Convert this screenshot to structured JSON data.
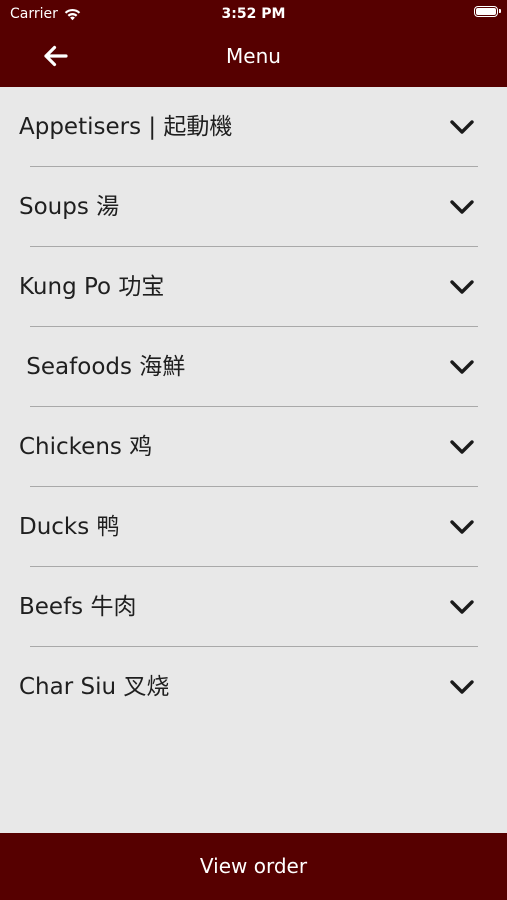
{
  "status_bar": {
    "carrier": "Carrier",
    "time": "3:52 PM",
    "icons": [
      "wifi-icon",
      "battery-icon"
    ]
  },
  "nav": {
    "title": "Menu",
    "back_icon": "arrow-left-icon"
  },
  "categories": [
    {
      "label": "Appetisers | 起動機",
      "icon": "chevron-down-icon"
    },
    {
      "label": "Soups 湯",
      "icon": "chevron-down-icon"
    },
    {
      "label": "Kung Po 功宝",
      "icon": "chevron-down-icon"
    },
    {
      "label": " Seafoods 海鮮",
      "icon": "chevron-down-icon"
    },
    {
      "label": "Chickens 鸡",
      "icon": "chevron-down-icon"
    },
    {
      "label": "Ducks 鸭",
      "icon": "chevron-down-icon"
    },
    {
      "label": "Beefs 牛肉",
      "icon": "chevron-down-icon"
    },
    {
      "label": "Char Siu 叉烧",
      "icon": "chevron-down-icon"
    }
  ],
  "footer": {
    "view_order_label": "View order"
  },
  "colors": {
    "brand": "#560000",
    "background": "#e8e8e8",
    "divider": "#a9a9a9",
    "text": "#1f1f1f"
  }
}
